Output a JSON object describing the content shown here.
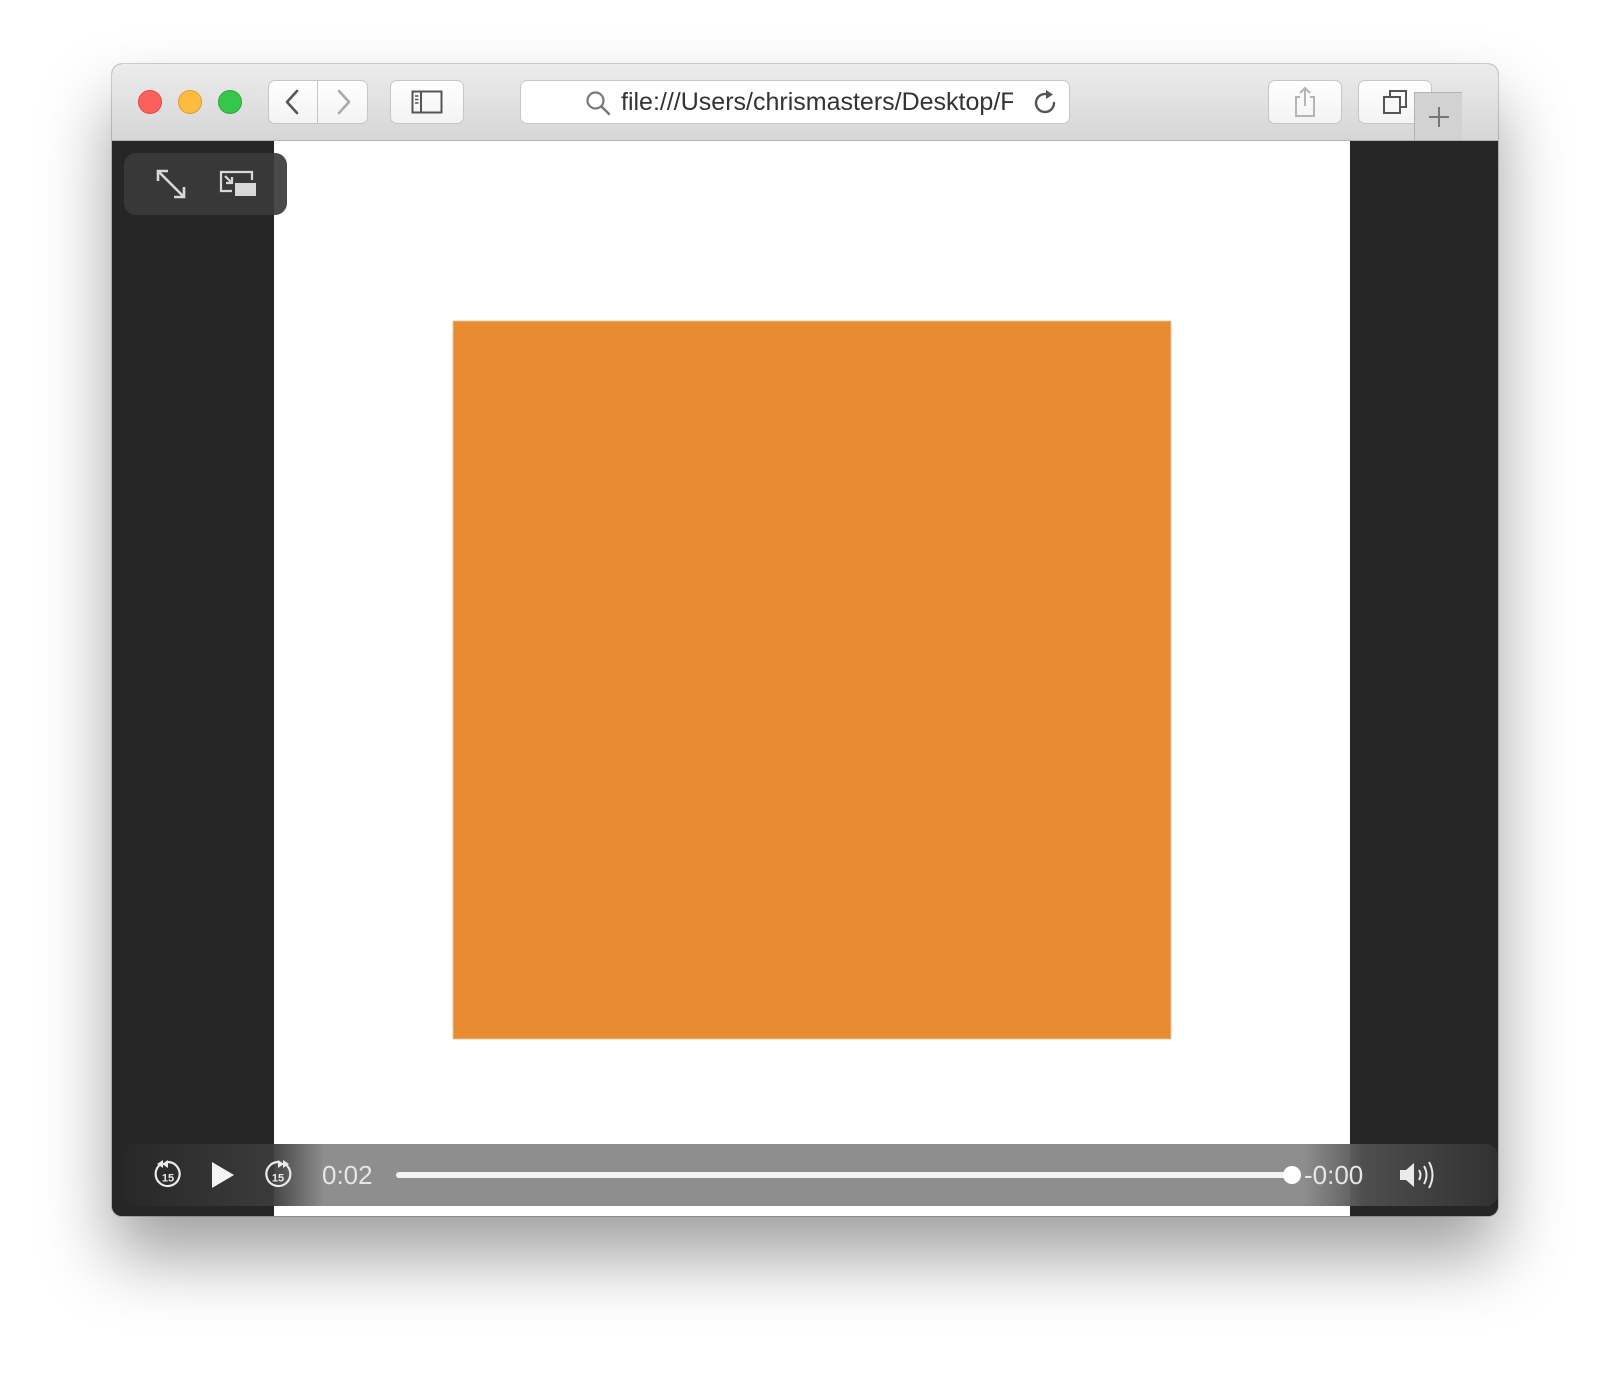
{
  "browser": {
    "address_bar": {
      "url": "file:///Users/chrismasters/Desktop/F",
      "search_icon": "magnifier-icon",
      "reload_icon": "reload-icon"
    },
    "toolbar": {
      "icons": {
        "back": "chevron-left-icon",
        "forward": "chevron-right-icon",
        "sidebar": "sidebar-icon",
        "share": "share-icon",
        "tabs": "tab-overview-icon",
        "new_tab": "plus-icon"
      }
    },
    "traffic_lights": {
      "close": "#fc605b",
      "minimize": "#fdbc40",
      "zoom": "#34c84a"
    }
  },
  "video_player": {
    "content_color": "#e98b33",
    "top_controls": {
      "fullscreen_icon": "fullscreen-icon",
      "pip_icon": "picture-in-picture-icon"
    },
    "controls": {
      "skip_back_label": "15",
      "skip_forward_label": "15",
      "play_icon": "play-icon",
      "time_elapsed": "0:02",
      "time_remaining": "-0:00",
      "progress": 1.0,
      "volume_icon": "volume-icon"
    }
  }
}
